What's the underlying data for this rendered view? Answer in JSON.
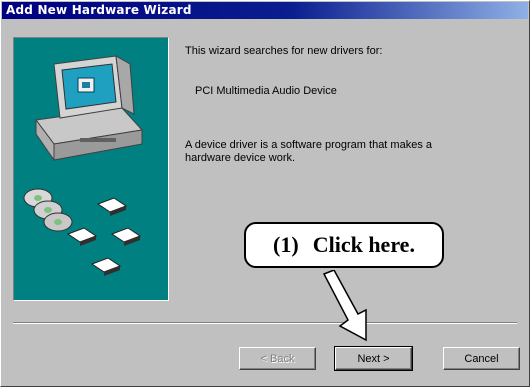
{
  "window": {
    "title": "Add New Hardware Wizard"
  },
  "content": {
    "intro": "This wizard searches for new drivers for:",
    "device": "PCI Multimedia Audio Device",
    "description_line1": "A device driver is a software program that makes a",
    "description_line2": "hardware device work."
  },
  "buttons": {
    "back": "< Back",
    "next": "Next >",
    "cancel": "Cancel"
  },
  "callout": {
    "step": "(1)",
    "text": "Click here."
  },
  "colors": {
    "titlebar": "#000080",
    "panel": "#008080",
    "face": "#c0c0c0"
  },
  "icons": [
    "monitor-icon",
    "computer-icon",
    "cd-icon",
    "diskette-icon"
  ]
}
